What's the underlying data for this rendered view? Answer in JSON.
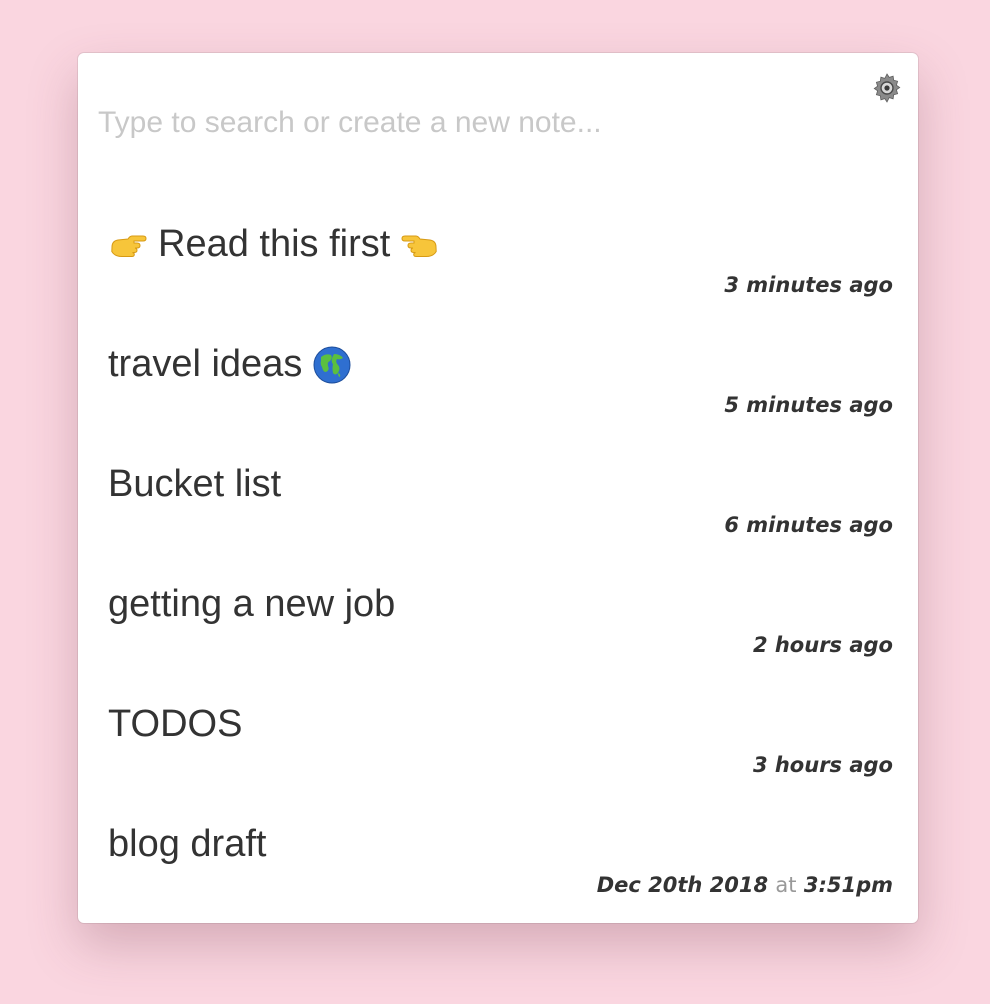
{
  "app": {
    "search_placeholder": "Type to search or create a new note...",
    "settings_icon": "gear-icon",
    "accent_background": "#fad6e0"
  },
  "notes": [
    {
      "title": "Read this first",
      "leading_icon": "pointing-right-hand-icon",
      "trailing_icon": "pointing-left-hand-icon",
      "time": "3 minutes ago"
    },
    {
      "title": "travel ideas",
      "trailing_icon": "globe-icon",
      "time": "5 minutes ago"
    },
    {
      "title": "Bucket list",
      "time": "6 minutes ago"
    },
    {
      "title": "getting a new job",
      "time": "2 hours ago"
    },
    {
      "title": "TODOS",
      "time": "3 hours ago"
    },
    {
      "title": "blog draft",
      "time_date": "Dec 20th 2018",
      "time_sep": "at",
      "time_clock": "3:51pm"
    }
  ]
}
